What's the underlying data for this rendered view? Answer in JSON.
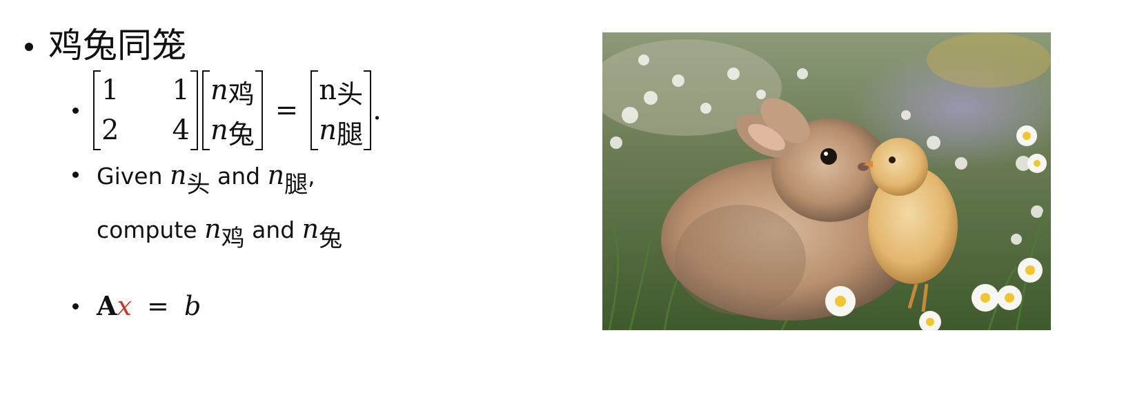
{
  "heading": "鸡兔同笼",
  "equation": {
    "matrix_A": [
      [
        "1",
        "1"
      ],
      [
        "2",
        "4"
      ]
    ],
    "vector_x": [
      {
        "var": "n",
        "sub": "鸡"
      },
      {
        "var": "n",
        "sub": "兔"
      }
    ],
    "equals": "=",
    "vector_b": [
      {
        "var": "n",
        "sub": "头"
      },
      {
        "var": "n",
        "sub": "腿"
      }
    ],
    "trailing": "."
  },
  "given": {
    "line1_a": "Given",
    "line1_var1": "n",
    "line1_sub1": "头",
    "line1_b": "and",
    "line1_var2": "n",
    "line1_sub2": "腿",
    "line1_c": ",",
    "line2_a": "compute",
    "line2_var1": "n",
    "line2_sub1": "鸡",
    "line2_b": "and",
    "line2_var2": "n",
    "line2_sub2": "兔"
  },
  "axb": {
    "A": "A",
    "x": "x",
    "eq": "=",
    "b": "b"
  },
  "colors": {
    "highlight_x": "#c23a2b",
    "text": "#111111"
  },
  "photo": {
    "subject": "bunny-and-chick-photo"
  }
}
